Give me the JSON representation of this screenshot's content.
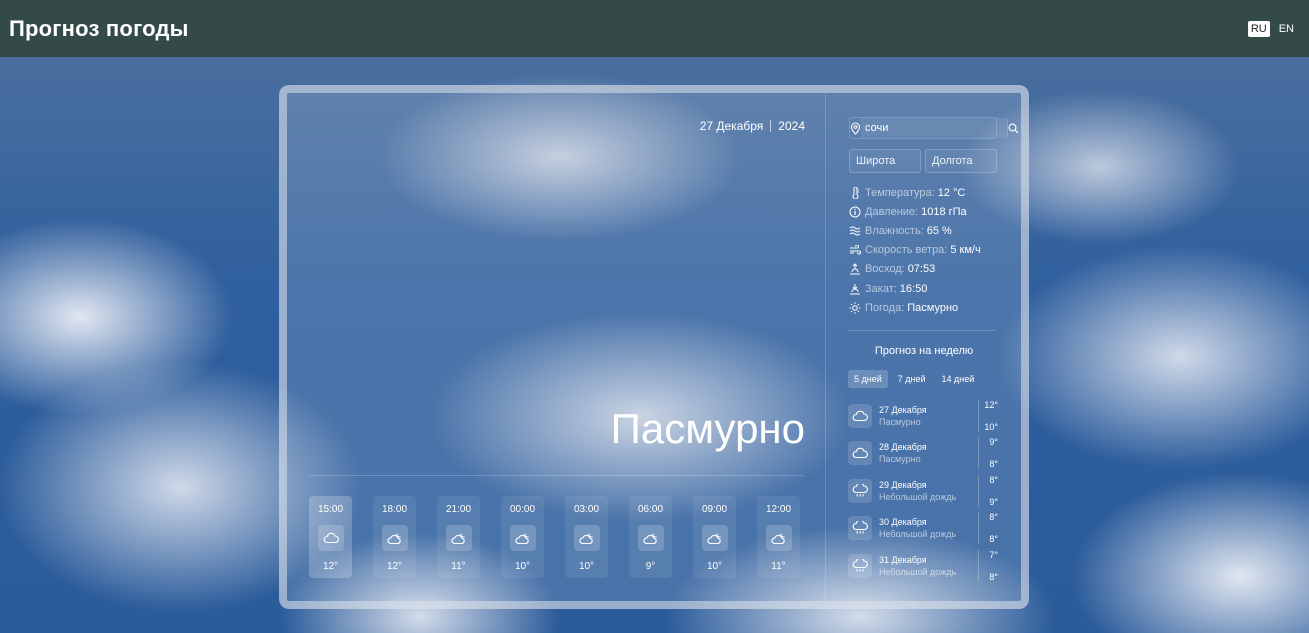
{
  "header": {
    "title": "Прогноз погоды"
  },
  "language": {
    "options": [
      "RU",
      "EN"
    ],
    "active": "RU"
  },
  "current": {
    "date": "27 Декабря",
    "year": "2024",
    "condition": "Пасмурно"
  },
  "hourly": [
    {
      "time": "15:00",
      "temp": "12°",
      "icon": "cloud-icon",
      "active": true
    },
    {
      "time": "18:00",
      "temp": "12°",
      "icon": "cloud-moon-icon",
      "active": false
    },
    {
      "time": "21:00",
      "temp": "11°",
      "icon": "cloud-moon-icon",
      "active": false
    },
    {
      "time": "00:00",
      "temp": "10°",
      "icon": "cloud-moon-icon",
      "active": false
    },
    {
      "time": "03:00",
      "temp": "10°",
      "icon": "cloud-moon-icon",
      "active": false
    },
    {
      "time": "06:00",
      "temp": "9°",
      "icon": "cloud-moon-icon",
      "active": false
    },
    {
      "time": "09:00",
      "temp": "10°",
      "icon": "cloud-moon-icon",
      "active": false
    },
    {
      "time": "12:00",
      "temp": "11°",
      "icon": "cloud-moon-icon",
      "active": false
    }
  ],
  "search": {
    "value": "сочи",
    "lat_placeholder": "Широта",
    "lon_placeholder": "Долгота"
  },
  "stats": [
    {
      "label": "Температура:",
      "value": "12 °C",
      "icon": "thermometer-icon"
    },
    {
      "label": "Давление:",
      "value": "1018 гПа",
      "icon": "info-icon"
    },
    {
      "label": "Влажность:",
      "value": "65 %",
      "icon": "humidity-icon"
    },
    {
      "label": "Скорость ветра:",
      "value": "5 км/ч",
      "icon": "wind-icon"
    },
    {
      "label": "Восход:",
      "value": "07:53",
      "icon": "sunrise-icon"
    },
    {
      "label": "Закат:",
      "value": "16:50",
      "icon": "sunset-icon"
    },
    {
      "label": "Погода:",
      "value": "Пасмурно",
      "icon": "sun-icon"
    }
  ],
  "week": {
    "title": "Прогноз на неделю",
    "tabs": [
      "5 дней",
      "7 дней",
      "14 дней"
    ],
    "active_tab": "5 дней",
    "days": [
      {
        "date": "27 Декабря",
        "condition": "Пасмурно",
        "max": "12°",
        "min": "10°",
        "icon": "cloud-icon"
      },
      {
        "date": "28 Декабря",
        "condition": "Пасмурно",
        "max": "9°",
        "min": "8°",
        "icon": "cloud-icon"
      },
      {
        "date": "29 Декабря",
        "condition": "Небольшой дождь",
        "max": "8°",
        "min": "9°",
        "icon": "cloud-rain-icon"
      },
      {
        "date": "30 Декабря",
        "condition": "Небольшой дождь",
        "max": "8°",
        "min": "8°",
        "icon": "cloud-rain-icon"
      },
      {
        "date": "31 Декабря",
        "condition": "Небольшой дождь",
        "max": "7°",
        "min": "8°",
        "icon": "cloud-rain-icon"
      }
    ]
  }
}
